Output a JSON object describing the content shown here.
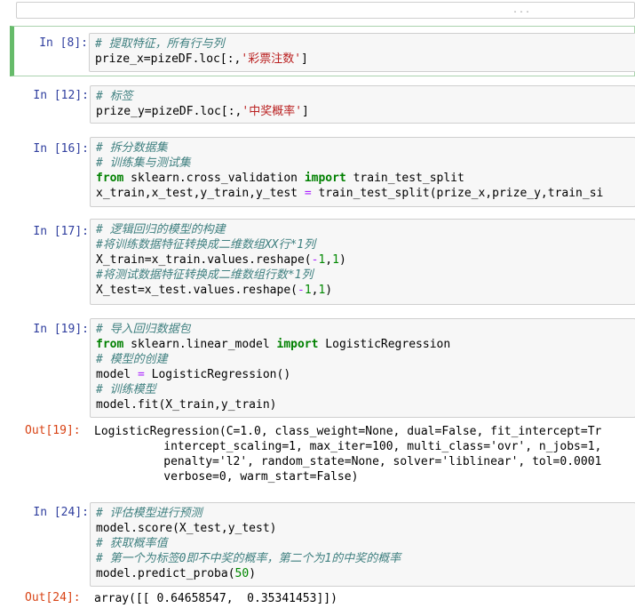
{
  "collapsed_cell": {
    "ellipsis": "..."
  },
  "cells": [
    {
      "prompt": "In [8]:",
      "lines": [
        [
          [
            "cm",
            "# 提取特征，所有行与列"
          ]
        ],
        [
          [
            "n",
            "prize_x=pizeDF.loc[:,"
          ],
          [
            "str",
            "'彩票注数'"
          ],
          [
            "n",
            "]"
          ]
        ]
      ]
    },
    {
      "prompt": "In [12]:",
      "lines": [
        [
          [
            "cm",
            "# 标签"
          ]
        ],
        [
          [
            "n",
            "prize_y=pizeDF.loc[:,"
          ],
          [
            "str",
            "'中奖概率'"
          ],
          [
            "n",
            "]"
          ]
        ]
      ]
    },
    {
      "prompt": "In [16]:",
      "lines": [
        [
          [
            "cm",
            "# 拆分数据集"
          ]
        ],
        [
          [
            "cm",
            "# 训练集与测试集"
          ]
        ],
        [
          [
            "kw",
            "from"
          ],
          [
            "n",
            " sklearn.cross_validation "
          ],
          [
            "kw",
            "import"
          ],
          [
            "n",
            " train_test_split"
          ]
        ],
        [
          [
            "n",
            "x_train,x_test,y_train,y_test "
          ],
          [
            "op",
            "="
          ],
          [
            "n",
            " train_test_split(prize_x,prize_y,train_si"
          ]
        ]
      ]
    },
    {
      "prompt": "In [17]:",
      "lines": [
        [
          [
            "cm",
            "# 逻辑回归的模型的构建"
          ]
        ],
        [
          [
            "cm",
            "#将训练数据特征转换成二维数组XX行*1列"
          ]
        ],
        [
          [
            "n",
            "X_train=x_train.values.reshape("
          ],
          [
            "op",
            "-"
          ],
          [
            "num",
            "1"
          ],
          [
            "n",
            ","
          ],
          [
            "num",
            "1"
          ],
          [
            "n",
            ")"
          ]
        ],
        [
          [
            "cm",
            "#将测试数据特征转换成二维数组行数*1列"
          ]
        ],
        [
          [
            "n",
            "X_test=x_test.values.reshape("
          ],
          [
            "op",
            "-"
          ],
          [
            "num",
            "1"
          ],
          [
            "n",
            ","
          ],
          [
            "num",
            "1"
          ],
          [
            "n",
            ")"
          ]
        ]
      ]
    },
    {
      "prompt": "In [19]:",
      "lines": [
        [
          [
            "cm",
            "# 导入回归数据包"
          ]
        ],
        [
          [
            "kw",
            "from"
          ],
          [
            "n",
            " sklearn.linear_model "
          ],
          [
            "kw",
            "import"
          ],
          [
            "n",
            " LogisticRegression"
          ]
        ],
        [
          [
            "cm",
            "# 模型的创建"
          ]
        ],
        [
          [
            "n",
            "model "
          ],
          [
            "op",
            "="
          ],
          [
            "n",
            " LogisticRegression()"
          ]
        ],
        [
          [
            "cm",
            "# 训练模型"
          ]
        ],
        [
          [
            "n",
            "model.fit(X_train,y_train)"
          ]
        ]
      ]
    },
    {
      "prompt": "In [24]:",
      "lines": [
        [
          [
            "cm",
            "# 评估模型进行预测"
          ]
        ],
        [
          [
            "n",
            "model.score(X_test,y_test)"
          ]
        ],
        [
          [
            "cm",
            "# 获取概率值"
          ]
        ],
        [
          [
            "cm",
            "# 第一个为标签0即不中奖的概率，第二个为1的中奖的概率"
          ]
        ],
        [
          [
            "n",
            "model.predict_proba("
          ],
          [
            "num",
            "50"
          ],
          [
            "n",
            ")"
          ]
        ]
      ]
    }
  ],
  "outputs": [
    {
      "prompt": "Out[19]:",
      "lines": [
        "LogisticRegression(C=1.0, class_weight=None, dual=False, fit_intercept=Tr",
        "          intercept_scaling=1, max_iter=100, multi_class='ovr', n_jobs=1,",
        "          penalty='l2', random_state=None, solver='liblinear', tol=0.0001",
        "          verbose=0, warm_start=False)"
      ]
    },
    {
      "prompt": "Out[24]:",
      "lines": [
        "array([[ 0.64658547,  0.35341453]])"
      ]
    }
  ]
}
